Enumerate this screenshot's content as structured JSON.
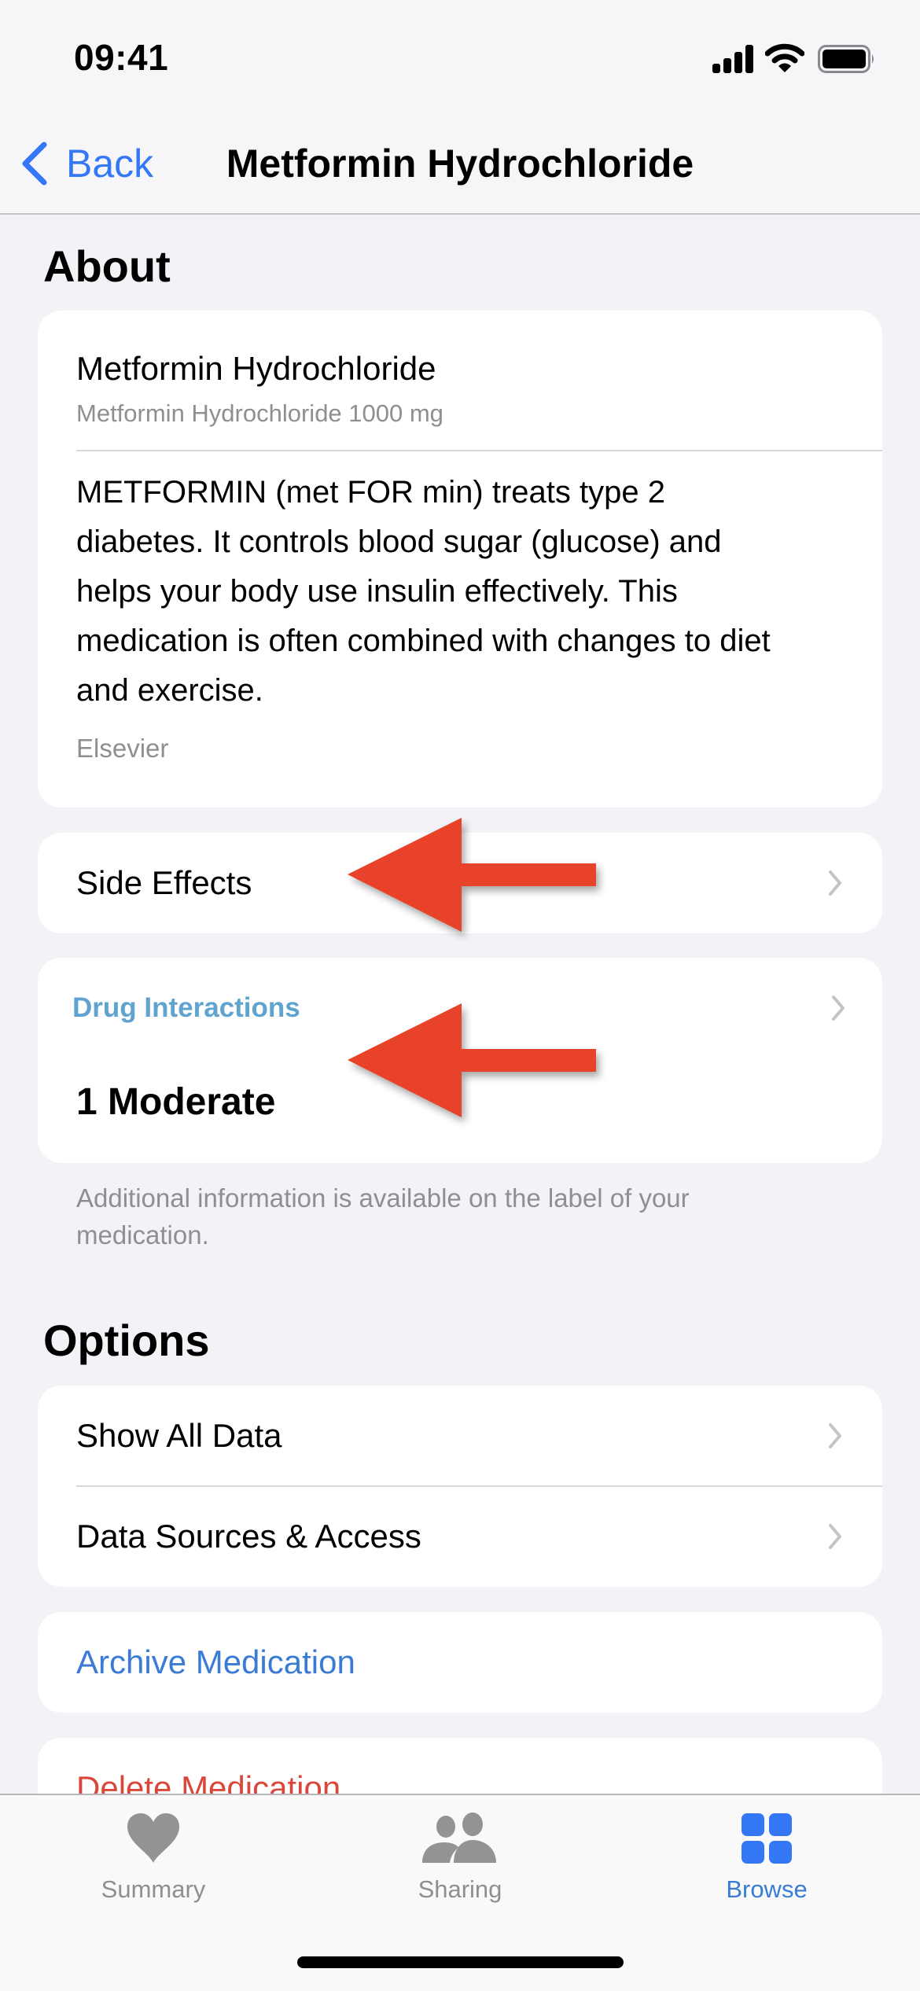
{
  "status_bar": {
    "time": "09:41",
    "icons": [
      "cellular-signal-icon",
      "wifi-icon",
      "battery-icon"
    ]
  },
  "nav": {
    "back_label": "Back",
    "back_icon": "chevron-left-icon",
    "title": "Metformin Hydrochloride"
  },
  "about": {
    "header": "About",
    "name": "Metformin Hydrochloride",
    "dosage": "Metformin Hydrochloride 1000 mg",
    "description_lines": [
      "METFORMIN (met FOR min) treats type 2",
      "diabetes. It controls blood sugar (glucose) and",
      "helps your body use insulin effectively. This",
      "medication is often combined with changes to diet",
      "and exercise."
    ],
    "source": "Elsevier"
  },
  "side_effects": {
    "label": "Side Effects"
  },
  "drug_interactions": {
    "header": "Drug Interactions",
    "summary": "1 Moderate",
    "footnote_lines": [
      "Additional information is available on the label of your",
      "medication."
    ]
  },
  "options": {
    "header": "Options",
    "items": [
      {
        "label": "Show All Data"
      },
      {
        "label": "Data Sources & Access"
      }
    ],
    "archive_label": "Archive Medication",
    "delete_label": "Delete Medication"
  },
  "annotations": {
    "arrow_color": "#e8432a",
    "arrows": [
      "points-to-side-effects",
      "points-to-drug-interactions"
    ]
  },
  "tab_bar": {
    "tabs": [
      {
        "label": "Summary",
        "icon": "heart-icon",
        "active": false
      },
      {
        "label": "Sharing",
        "icon": "people-icon",
        "active": false
      },
      {
        "label": "Browse",
        "icon": "grid-icon",
        "active": true
      }
    ]
  },
  "colors": {
    "accent": "#3478f6",
    "link_blue": "#3a7bd5",
    "interactions_blue": "#5fa3cf",
    "destructive": "#d9473a",
    "inactive_gray": "#8e8e93",
    "background": "#f2f2f7"
  }
}
